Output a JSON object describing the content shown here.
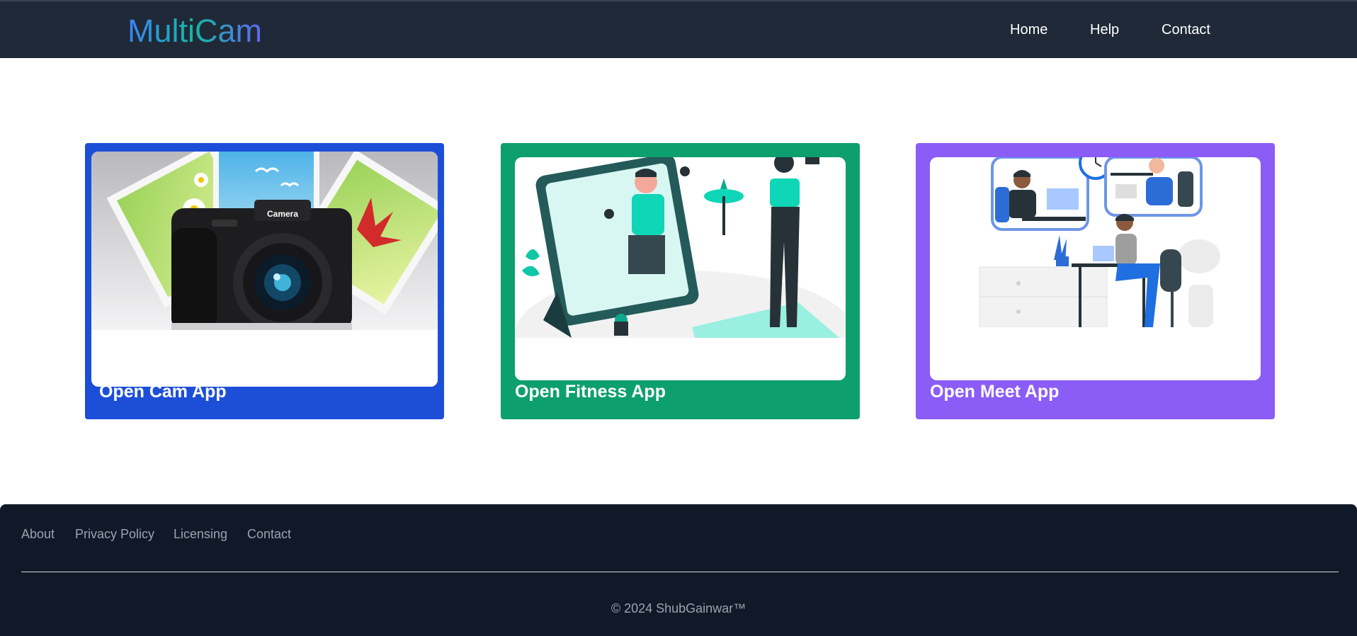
{
  "header": {
    "brand": "MultiCam",
    "nav": [
      {
        "label": "Home"
      },
      {
        "label": "Help"
      },
      {
        "label": "Contact"
      }
    ]
  },
  "cards": [
    {
      "label": "Open Cam App",
      "color": "#1d4ed8"
    },
    {
      "label": "Open Fitness App",
      "color": "#0e9f6e"
    },
    {
      "label": "Open Meet App",
      "color": "#8b5cf6"
    }
  ],
  "camera_illustration": {
    "camera_text": "Camera"
  },
  "footer": {
    "links": [
      {
        "label": "About"
      },
      {
        "label": "Privacy Policy"
      },
      {
        "label": "Licensing"
      },
      {
        "label": "Contact"
      }
    ],
    "copyright": "© 2024 ShubGainwar™"
  }
}
